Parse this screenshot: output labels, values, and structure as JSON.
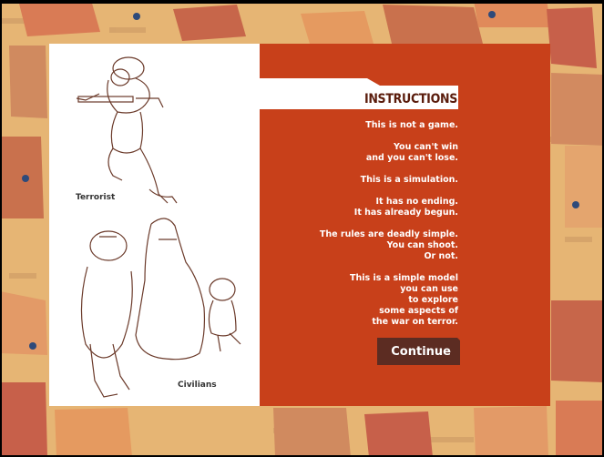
{
  "title": "INSTRUCTIONS",
  "labels": {
    "terrorist": "Terrorist",
    "civilians": "Civilians"
  },
  "instructions": [
    [
      "This is not a game."
    ],
    [
      "You can't win",
      "and you can't lose."
    ],
    [
      "This is a simulation."
    ],
    [
      "It has no ending.",
      "It has already begun."
    ],
    [
      "The rules are deadly simple.",
      "You can shoot.",
      "Or not."
    ],
    [
      "This is a simple model",
      "you can use",
      "to explore",
      "some aspects of",
      "the war on terror."
    ]
  ],
  "buttons": {
    "continue": "Continue"
  },
  "colors": {
    "panel": "#c8401a",
    "button": "#5c2c22",
    "title_text": "#5a1c0c"
  }
}
